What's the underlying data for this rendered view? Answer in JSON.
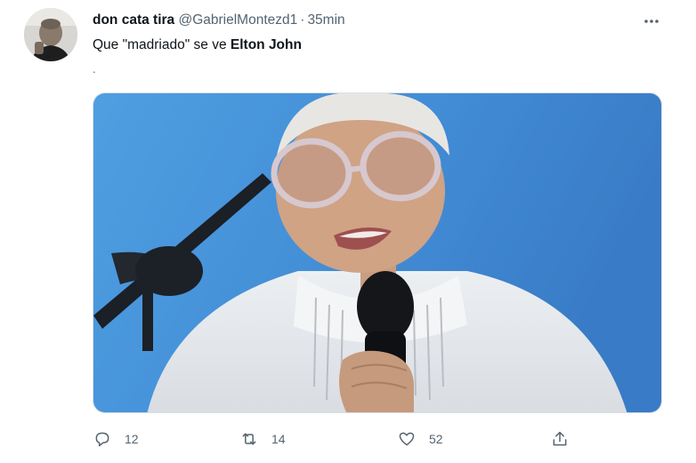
{
  "tweet": {
    "author": {
      "display_name": "don cata tira",
      "handle": "@GabrielMontezd1",
      "separator": "·",
      "timestamp": "35min"
    },
    "text_prefix": "Que \"madriado\" se ve ",
    "text_bold": "Elton John",
    "extra_line": ".",
    "media": {
      "type": "photo"
    },
    "actions": {
      "reply_count": "12",
      "retweet_count": "14",
      "like_count": "52"
    },
    "icons": {
      "more": "more-horizontal-icon",
      "reply": "reply-icon",
      "retweet": "retweet-icon",
      "like": "heart-icon",
      "share": "share-icon"
    }
  },
  "colors": {
    "text": "#0f1419",
    "secondary": "#536471",
    "media_background": "#3d8fd9"
  }
}
